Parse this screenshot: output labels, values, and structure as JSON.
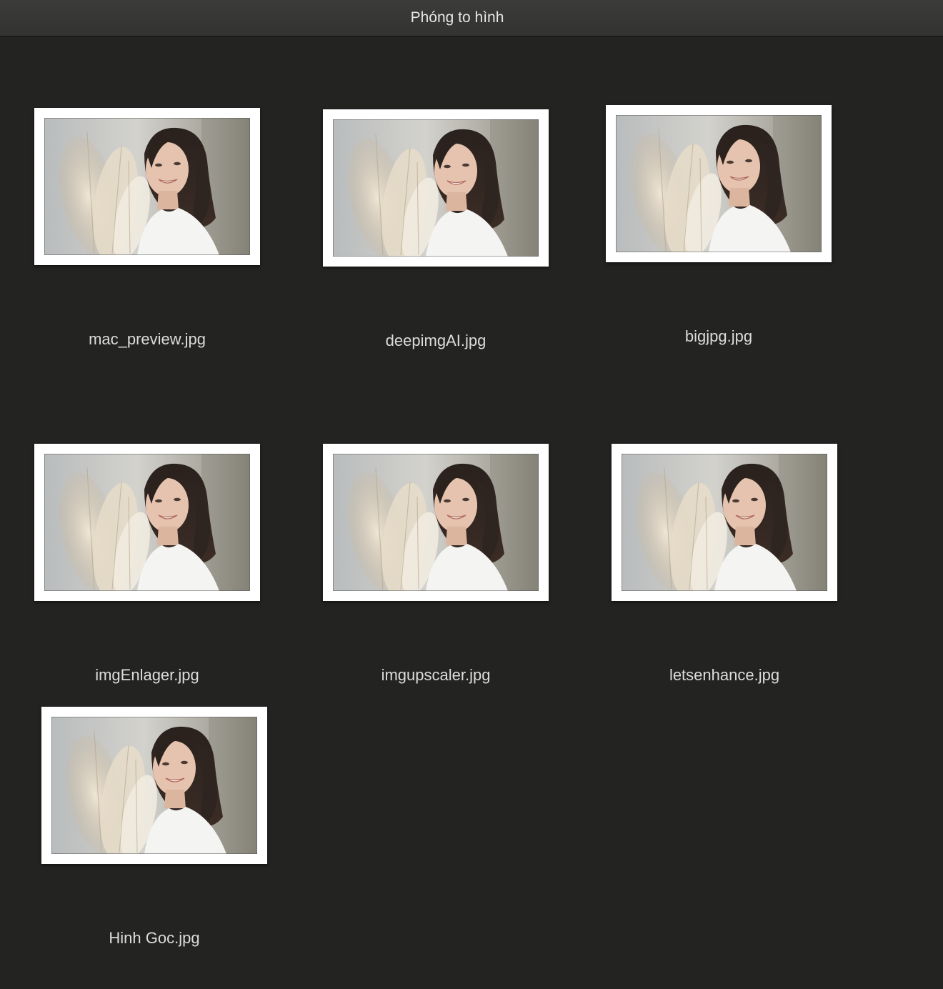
{
  "window": {
    "title": "Phóng to hình"
  },
  "files": [
    {
      "name": "mac_preview.jpg",
      "thumbnail": "woman-with-pampas-grass-photo"
    },
    {
      "name": "deepimgAI.jpg",
      "thumbnail": "woman-with-pampas-grass-photo"
    },
    {
      "name": "bigjpg.jpg",
      "thumbnail": "woman-with-pampas-grass-photo"
    },
    {
      "name": "imgEnlager.jpg",
      "thumbnail": "woman-with-pampas-grass-photo"
    },
    {
      "name": "imgupscaler.jpg",
      "thumbnail": "woman-with-pampas-grass-photo"
    },
    {
      "name": "letsenhance.jpg",
      "thumbnail": "woman-with-pampas-grass-photo"
    },
    {
      "name": "Hinh Goc.jpg",
      "thumbnail": "woman-with-pampas-grass-photo"
    }
  ]
}
